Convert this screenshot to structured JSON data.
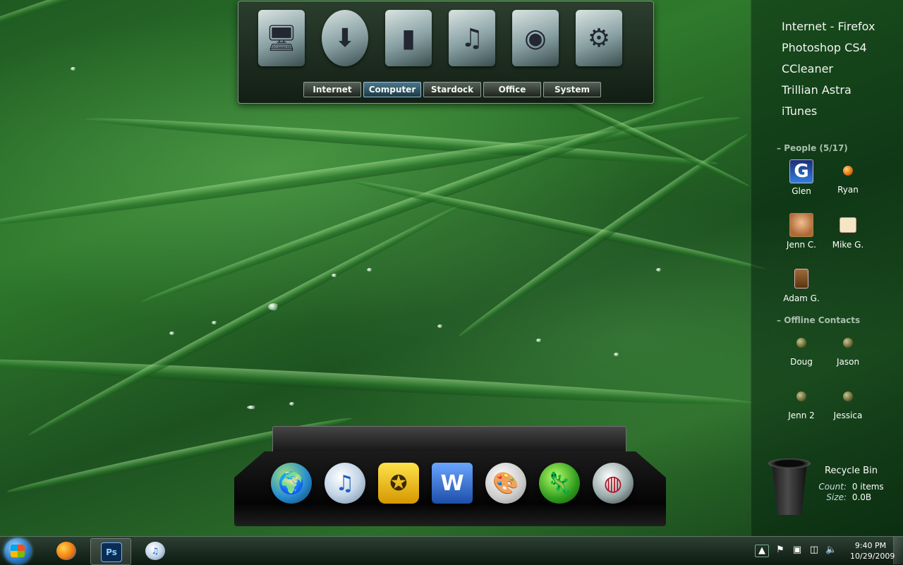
{
  "launcher": {
    "icons": [
      {
        "name": "monitor-icon",
        "glyph": "🖥"
      },
      {
        "name": "download-arrow-icon",
        "glyph": "⬇"
      },
      {
        "name": "folder-icon",
        "glyph": "▮"
      },
      {
        "name": "music-folder-icon",
        "glyph": "♫"
      },
      {
        "name": "pictures-folder-icon",
        "glyph": "◉"
      },
      {
        "name": "video-folder-icon",
        "glyph": "⚙"
      }
    ],
    "tabs": [
      {
        "label": "Internet",
        "active": false
      },
      {
        "label": "Computer",
        "active": true
      },
      {
        "label": "Stardock",
        "active": false
      },
      {
        "label": "Office",
        "active": false
      },
      {
        "label": "System",
        "active": false
      }
    ]
  },
  "sidebar": {
    "links": [
      "Internet - Firefox",
      "Photoshop CS4",
      "CCleaner",
      "Trillian Astra",
      "iTunes"
    ],
    "people_header": "People (5/17)",
    "people": [
      {
        "name": "Glen"
      },
      {
        "name": "Ryan"
      },
      {
        "name": "Jenn C."
      },
      {
        "name": "Mike G."
      },
      {
        "name": "Adam G."
      }
    ],
    "offline_header": "Offline Contacts",
    "offline": [
      {
        "name": "Doug"
      },
      {
        "name": "Jason"
      },
      {
        "name": "Jenn 2"
      },
      {
        "name": "Jessica"
      }
    ]
  },
  "recycle_bin": {
    "title": "Recycle Bin",
    "count_label": "Count:",
    "count_value": "0 items",
    "size_label": "Size:",
    "size_value": "0.0B"
  },
  "dock": {
    "icons": [
      {
        "name": "globe-icon",
        "glyph": "🌍"
      },
      {
        "name": "itunes-icon",
        "glyph": "♫"
      },
      {
        "name": "tools-shield-icon",
        "glyph": "✪"
      },
      {
        "name": "word-icon",
        "glyph": "W"
      },
      {
        "name": "paint-palette-icon",
        "glyph": "🎨"
      },
      {
        "name": "gecko-icon",
        "glyph": "🦎"
      },
      {
        "name": "settings-knob-icon",
        "glyph": "◍"
      }
    ]
  },
  "taskbar": {
    "photoshop_label": "Ps",
    "clock_time": "9:40 PM",
    "clock_date": "10/29/2009"
  }
}
